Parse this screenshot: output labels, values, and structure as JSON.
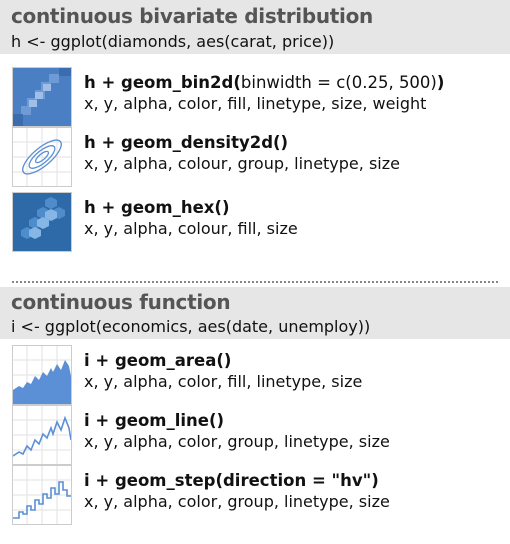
{
  "sections": [
    {
      "title": "continuous bivariate distribution",
      "code": "h <- ggplot(diamonds, aes(carat, price))",
      "items": [
        {
          "fn": "h + geom_bin2d(",
          "args": "binwidth = c(0.25, 500)",
          "close": ")",
          "aes": "x, y, alpha, color, fill, linetype, size, weight",
          "icon": "bin2d-plot-icon"
        },
        {
          "fn": "h + geom_density2d()",
          "args": "",
          "close": "",
          "aes": "x, y, alpha, colour, group, linetype, size",
          "icon": "density2d-plot-icon"
        },
        {
          "fn": "h + geom_hex()",
          "args": "",
          "close": "",
          "aes": "x, y, alpha, colour, fill, size",
          "icon": "hex-plot-icon"
        }
      ]
    },
    {
      "title": "continuous function",
      "code": "i <- ggplot(economics, aes(date, unemploy))",
      "items": [
        {
          "fn": "i + geom_area()",
          "args": "",
          "close": "",
          "aes": "x, y, alpha, color, fill, linetype, size",
          "icon": "area-plot-icon"
        },
        {
          "fn": "i + geom_line()",
          "args": "",
          "close": "",
          "aes": "x, y, alpha, color, group, linetype, size",
          "icon": "line-plot-icon"
        },
        {
          "fn": "i + geom_step(direction = \"hv\")",
          "args": "",
          "close": "",
          "aes": "x, y, alpha, color, group, linetype, size",
          "icon": "step-plot-icon"
        }
      ]
    }
  ],
  "colors": {
    "header_bg": "#e6e6e6",
    "title": "#555555",
    "plot_blue": "#5b8fd6",
    "plot_dark_blue": "#2f5f9f",
    "grid": "#e2e2e2"
  }
}
